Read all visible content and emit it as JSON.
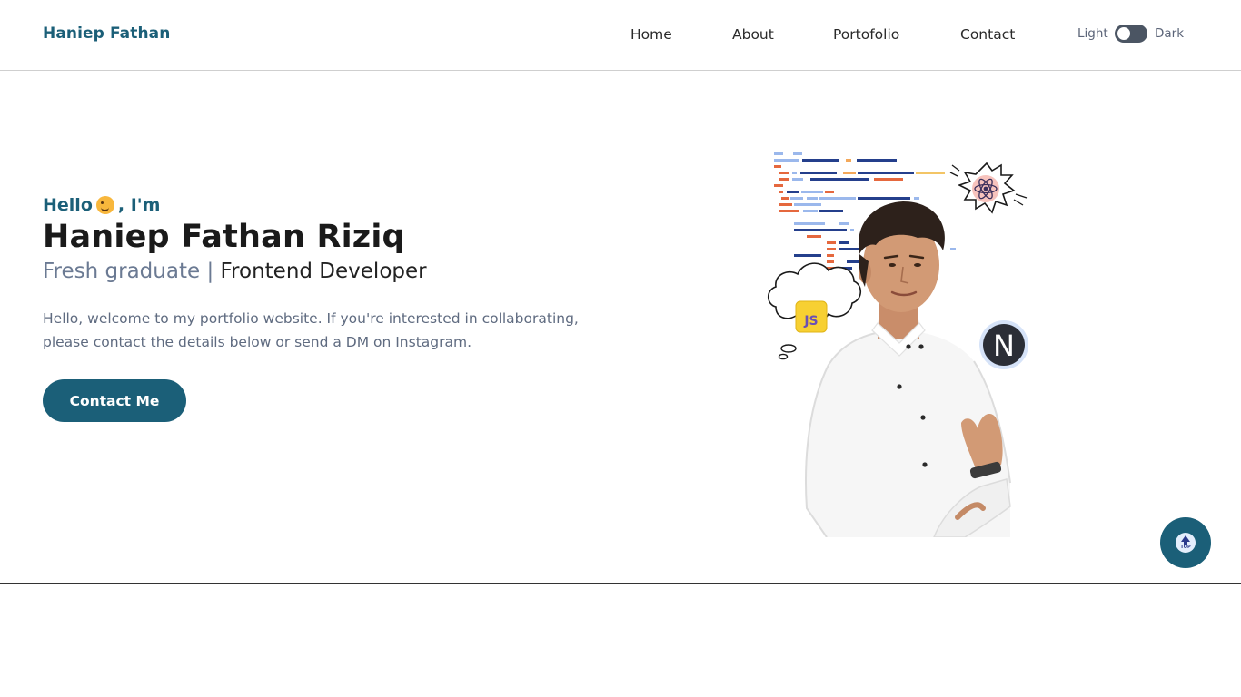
{
  "header": {
    "brand": "Haniep Fathan",
    "nav": [
      {
        "label": "Home"
      },
      {
        "label": "About"
      },
      {
        "label": "Portofolio"
      },
      {
        "label": "Contact"
      }
    ],
    "theme_toggle": {
      "light_label": "Light",
      "dark_label": "Dark",
      "selected": "Light"
    }
  },
  "hero": {
    "greeting_before": "Hello",
    "greeting_emoji": "winking-face-icon",
    "greeting_after": ", I'm",
    "name": "Haniep Fathan Riziq",
    "role_status": "Fresh graduate",
    "role_separator": "|",
    "role_title": "Frontend Developer",
    "description": "Hello, welcome to my portfolio website. If you're interested in collaborating, please contact the details below or send a DM on Instagram.",
    "cta_label": "Contact Me",
    "illustration": {
      "badges": {
        "js": "JS",
        "next": "N"
      }
    }
  },
  "to_top": {
    "label": "TOP",
    "icon": "arrow-up-icon"
  },
  "colors": {
    "primary": "#1b5f78",
    "text_dark": "#1a1a1a",
    "text_muted": "#5f6b80",
    "toggle_track": "#4b5563"
  }
}
